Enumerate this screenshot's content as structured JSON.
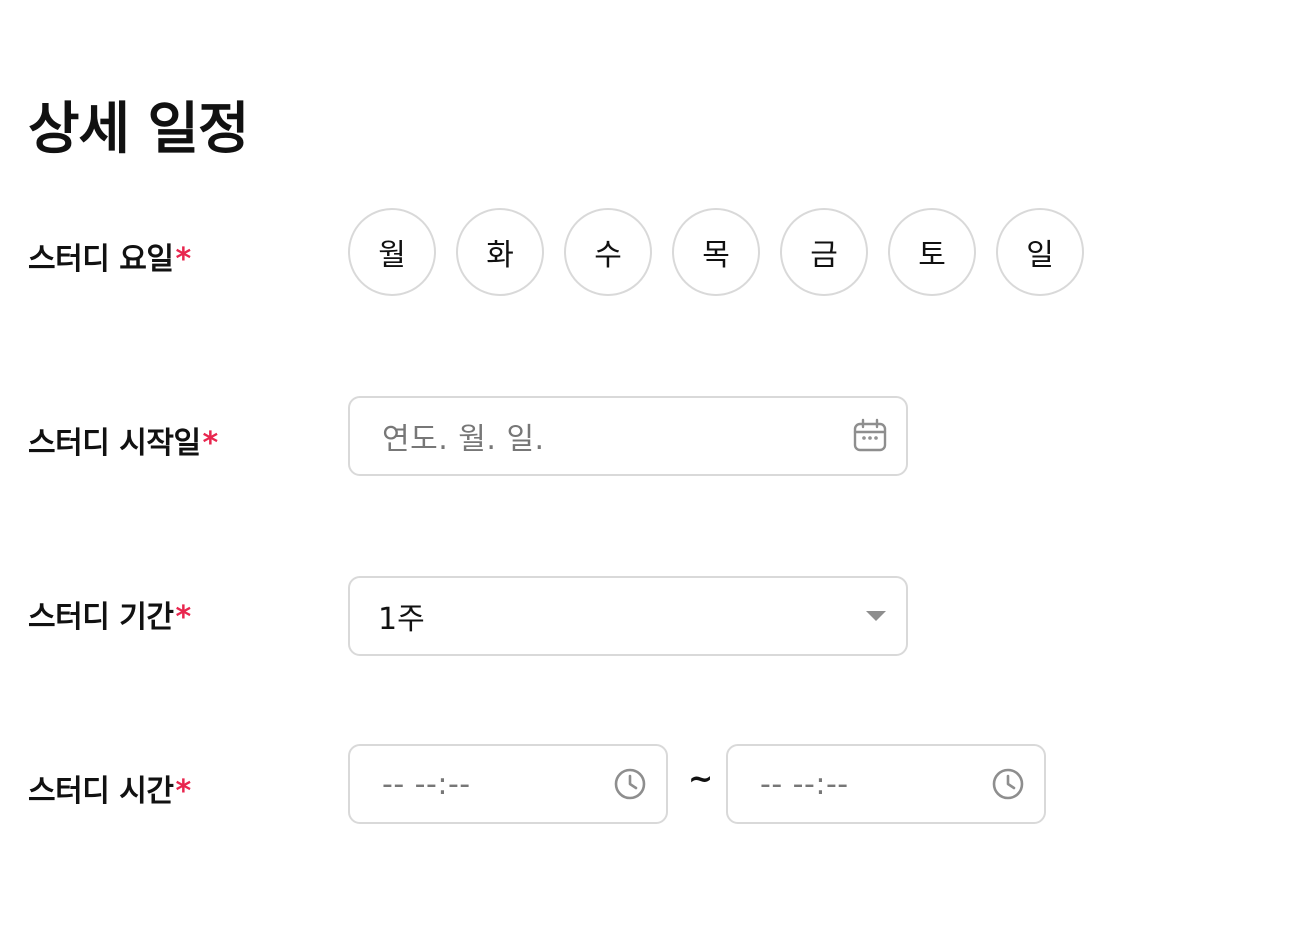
{
  "section": {
    "title": "상세 일정"
  },
  "study_days": {
    "label": "스터디 요일",
    "required_mark": "*",
    "options": [
      "월",
      "화",
      "수",
      "목",
      "금",
      "토",
      "일"
    ]
  },
  "start_date": {
    "label": "스터디 시작일",
    "required_mark": "*",
    "placeholder": "연도. 월. 일.",
    "icon": "calendar-icon"
  },
  "duration": {
    "label": "스터디 기간",
    "required_mark": "*",
    "selected": "1주",
    "icon": "caret-down-icon"
  },
  "time": {
    "label": "스터디 시간",
    "required_mark": "*",
    "start_placeholder": "-- --:--",
    "separator": "~",
    "end_placeholder": "-- --:--",
    "icon": "clock-icon"
  },
  "colors": {
    "required": "#e8264e",
    "border": "#d9d9d9",
    "icon": "#8e8e8e"
  }
}
